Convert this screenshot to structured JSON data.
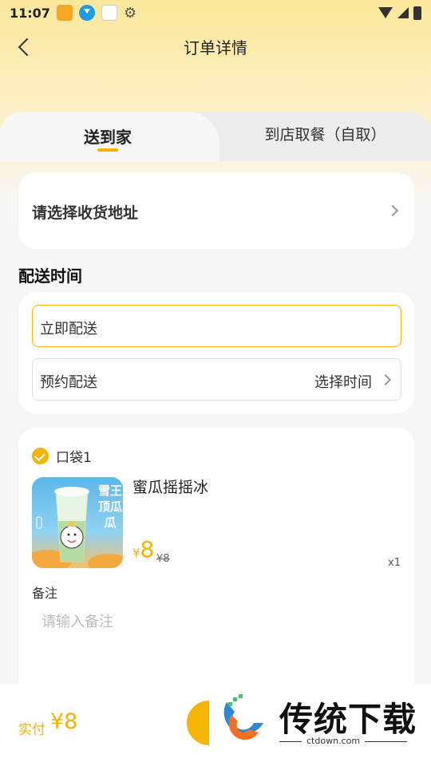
{
  "status_bar": {
    "time": "11:07",
    "icons": [
      "app-icon-orange",
      "download-icon",
      "app-icon-white",
      "gear-icon",
      "wifi-icon",
      "signal-icon",
      "battery-icon"
    ]
  },
  "nav": {
    "title": "订单详情",
    "back_icon": "chevron-left-icon"
  },
  "tabs": {
    "active": "送到家",
    "inactive": "到店取餐（自取）"
  },
  "address": {
    "label": "请选择收货地址"
  },
  "delivery": {
    "section_title": "配送时间",
    "immediate_label": "立即配送",
    "scheduled_label": "预约配送",
    "scheduled_value": "选择时间"
  },
  "order": {
    "bag_label": "口袋1",
    "product_name": "蜜瓜摇摇冰",
    "image_text": "雪王顶瓜瓜",
    "price_symbol": "¥",
    "price_now": "8",
    "price_old": "¥8",
    "quantity": "x1",
    "note_label": "备注",
    "note_placeholder": "请输入备注"
  },
  "footer": {
    "total_label": "实付",
    "total_value": "¥8"
  },
  "watermark": {
    "text": "传统下载",
    "url": "ctdown.com"
  },
  "colors": {
    "accent": "#f2b400",
    "header_gradient_top": "#fbe89a",
    "background": "#f6f6f6"
  }
}
